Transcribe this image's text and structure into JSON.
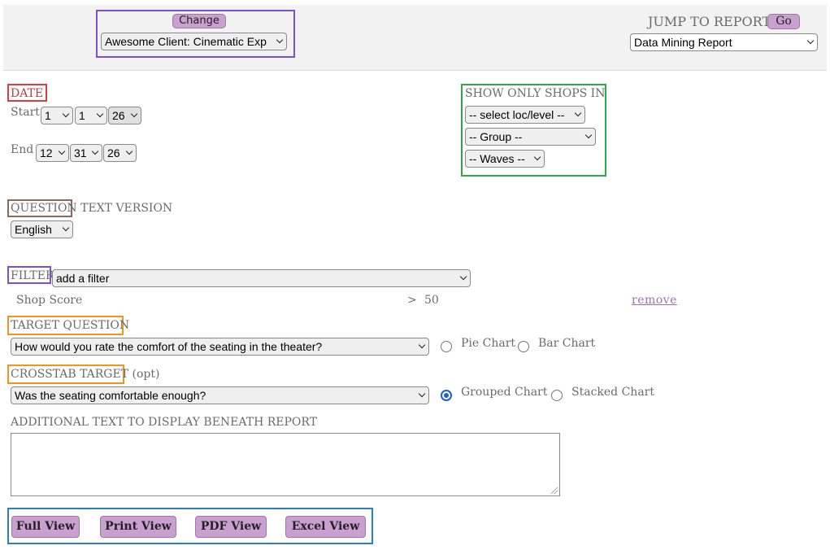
{
  "top": {
    "change_label": "Change",
    "client_select": "Awesome Client: Cinematic Exp",
    "jump_label": "JUMP TO REPORT",
    "go_label": "Go",
    "report_select": "Data Mining Report"
  },
  "date": {
    "label": "DATE",
    "start_label": "Start",
    "start_month": "1",
    "start_day": "1",
    "start_year": "26",
    "end_label": "End",
    "end_month": "12",
    "end_day": "31",
    "end_year": "26"
  },
  "shops": {
    "label": "SHOW ONLY SHOPS IN",
    "loc_select": "-- select loc/level --",
    "group_select": "-- Group --",
    "waves_select": "-- Waves --"
  },
  "question": {
    "label": "QUESTION",
    "label_suffix": " TEXT VERSION",
    "language_select": "English"
  },
  "filter": {
    "label": "FILTER",
    "select": "add a filter",
    "row_name": "Shop Score",
    "row_op": ">",
    "row_value": "50",
    "remove_label": "remove"
  },
  "target": {
    "label": "TARGET QUESTION",
    "select": "How would you rate the comfort of the seating in the theater?",
    "pie_label": "Pie Chart",
    "bar_label": "Bar Chart"
  },
  "crosstab": {
    "label": "CROSSTAB TARGET",
    "opt_label": " (opt)",
    "select": "Was the seating comfortable enough?",
    "grouped_label": "Grouped Chart",
    "stacked_label": "Stacked Chart"
  },
  "additional": {
    "label": "ADDITIONAL TEXT TO DISPLAY BENEATH REPORT",
    "value": ""
  },
  "views": {
    "full": "Full View",
    "print": "Print View",
    "pdf": "PDF View",
    "excel": "Excel View"
  },
  "colors": {
    "button_purple": "#c9a0d0",
    "box_purple": "#7b4fd6",
    "box_red": "#e03c3c",
    "box_green": "#2fa84a",
    "box_brown": "#8a6a5a",
    "box_orange": "#f0961e",
    "box_blue": "#2a7fc9"
  }
}
